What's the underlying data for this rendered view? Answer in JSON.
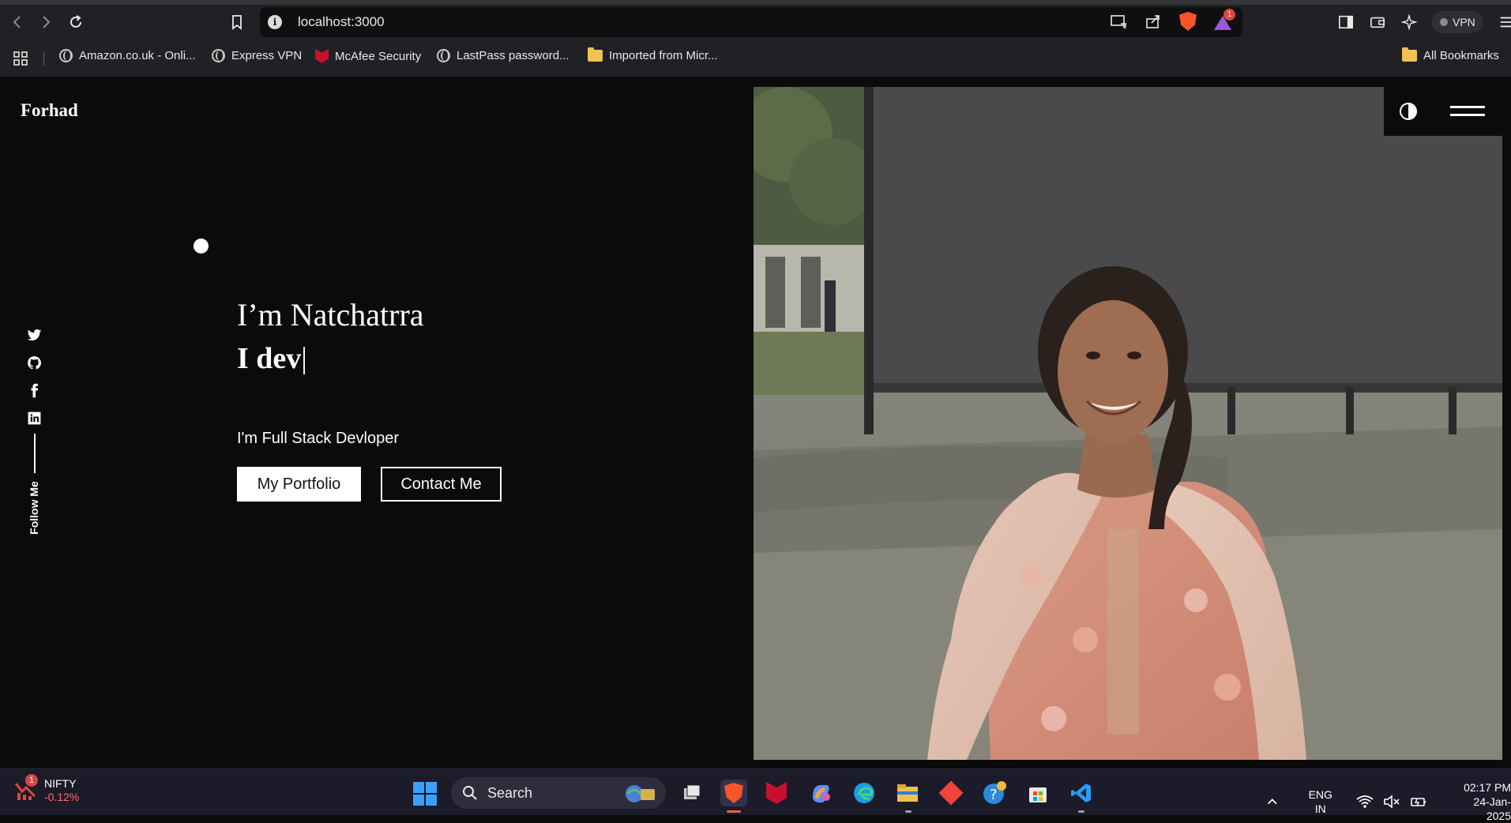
{
  "browser": {
    "url": "localhost:3000",
    "rewards_badge": "1",
    "vpn_label": "VPN",
    "bookmarks": [
      {
        "label": "Amazon.co.uk - Onli...",
        "icon": "globe-icon"
      },
      {
        "label": "Express VPN",
        "icon": "globe-icon"
      },
      {
        "label": "McAfee Security",
        "icon": "mcafee-icon"
      },
      {
        "label": "LastPass password...",
        "icon": "globe-icon"
      },
      {
        "label": "Imported from Micr...",
        "icon": "folder-icon"
      }
    ],
    "all_bookmarks": "All Bookmarks"
  },
  "page": {
    "logo": "Forhad",
    "hero_name": "I’m Natchatrra",
    "hero_typed": "I dev",
    "hero_caret": "|",
    "hero_subtitle": "I'm Full Stack Devloper",
    "btn_portfolio": "My Portfolio",
    "btn_contact": "Contact Me",
    "follow_me": "Follow Me",
    "social_icons": [
      "twitter-icon",
      "github-icon",
      "facebook-icon",
      "linkedin-icon"
    ]
  },
  "taskbar": {
    "nifty_badge": "1",
    "nifty_label": "NIFTY",
    "nifty_change": "-0.12%",
    "search_label": "Search",
    "lang_line1": "ENG",
    "lang_line2": "IN",
    "time": "02:17 PM",
    "date": "24-Jan-2025"
  },
  "colors": {
    "page_bg": "#0b0b0b",
    "chrome_bg": "#202124",
    "taskbar_bg": "#1c1b2a",
    "brave_orange": "#fb542b",
    "nifty_negative": "#ff6b6b"
  }
}
